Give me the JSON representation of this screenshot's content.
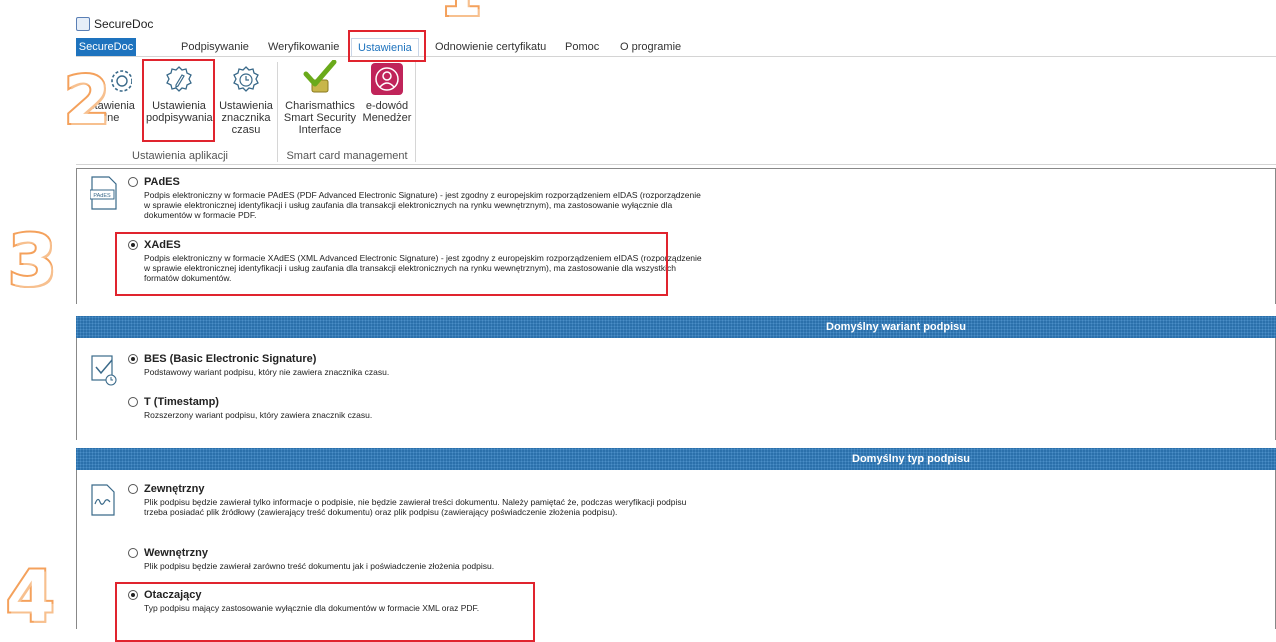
{
  "app": {
    "title": "SecureDoc"
  },
  "menu": {
    "items": [
      "SecureDoc",
      "Podpisywanie",
      "Weryfikowanie",
      "Ustawienia",
      "Odnowienie certyfikatu",
      "Pomoc",
      "O programie"
    ]
  },
  "ribbon": {
    "app_settings": {
      "group_label": "Ustawienia aplikacji",
      "btn_general": [
        "stawienia",
        "lne"
      ],
      "btn_signing": [
        "Ustawienia",
        "podpisywania"
      ],
      "btn_timestamp": [
        "Ustawienia",
        "znacznika",
        "czasu"
      ]
    },
    "smart_card": {
      "group_label": "Smart card management",
      "btn_charismathics": [
        "Charismathics",
        "Smart Security",
        "Interface"
      ],
      "btn_edowod": [
        "e-dowód",
        "Menedżer"
      ]
    }
  },
  "annotations": {
    "n1": "1",
    "n2": "2",
    "n3": "3",
    "n4": "4"
  },
  "format": {
    "pades": {
      "label": "PAdES",
      "desc": "Podpis elektroniczny w formacie PAdES (PDF Advanced Electronic Signature) - jest zgodny z europejskim rozporządzeniem eIDAS (rozporządzenie w sprawie elektronicznej identyfikacji i usług zaufania dla transakcji elektronicznych na rynku wewnętrznym), ma zastosowanie wyłącznie dla dokumentów w formacie PDF.",
      "selected": false,
      "icon_text": "PAdES"
    },
    "xades": {
      "label": "XAdES",
      "desc": "Podpis elektroniczny w formacie XAdES (XML Advanced Electronic Signature) - jest zgodny z europejskim rozporządzeniem eIDAS (rozporządzenie w sprawie elektronicznej identyfikacji i usług zaufania dla transakcji elektronicznych na rynku wewnętrznym), ma zastosowanie dla wszystkich formatów dokumentów.",
      "selected": true
    }
  },
  "variant": {
    "header": "Domyślny wariant podpisu",
    "bes": {
      "label": "BES (Basic Electronic Signature)",
      "desc": "Podstawowy wariant podpisu, który nie zawiera znacznika czasu.",
      "selected": true
    },
    "t": {
      "label": "T (Timestamp)",
      "desc": "Rozszerzony wariant podpisu, który zawiera znacznik czasu.",
      "selected": false
    }
  },
  "type": {
    "header": "Domyślny typ podpisu",
    "external": {
      "label": "Zewnętrzny",
      "desc": "Plik podpisu będzie zawierał tylko informacje o podpisie, nie będzie zawierał treści dokumentu. Należy pamiętać że, podczas weryfikacji podpisu trzeba posiadać plik źródłowy (zawierający treść dokumentu) oraz plik podpisu (zawierający poświadczenie złożenia podpisu).",
      "selected": false
    },
    "internal": {
      "label": "Wewnętrzny",
      "desc": "Plik podpisu będzie zawierał zarówno treść dokumentu jak i poświadczenie złożenia podpisu.",
      "selected": false
    },
    "enveloping": {
      "label": "Otaczający",
      "desc": "Typ podpisu mający zastosowanie wyłącznie dla dokumentów w formacie XML oraz PDF.",
      "selected": true
    }
  },
  "colors": {
    "accent": "#1e73be",
    "annotation_red": "#e0242e",
    "annotation_orange": "#f4a15c",
    "section_header": "#2b70ab"
  }
}
